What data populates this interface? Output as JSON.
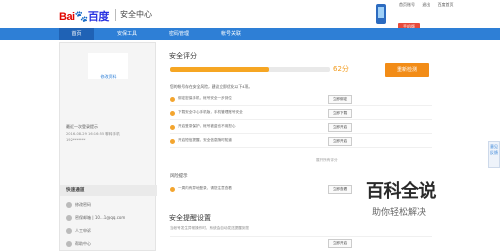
{
  "header": {
    "logo_prefix": "Bai",
    "logo_paw": "🐾",
    "logo_suffix": "百度",
    "product": "安全中心",
    "top_links": [
      "首页账号",
      "退出",
      "百度首页"
    ],
    "phone_badge": "手机版"
  },
  "nav": {
    "items": [
      {
        "label": "首页",
        "active": true
      },
      {
        "label": "安保工具",
        "active": false
      },
      {
        "label": "密码管理",
        "active": false
      },
      {
        "label": "帐号关联",
        "active": false
      }
    ]
  },
  "sidebar": {
    "avatar_link": "修改资料",
    "login_title": "最近一次登录提示",
    "login_lines": [
      "2016-08-29 16:16:55  聊转手机",
      "192*******"
    ],
    "quick_title": "快速通道",
    "quick_items": [
      "修改密码",
      "密保邮箱 | 10...1@qq.com",
      "人工申诉",
      "帮助中心"
    ]
  },
  "security": {
    "title": "安全评分",
    "score_label": "62分",
    "score_fraction": 0.62,
    "rescan_label": "重新检测",
    "risk_note": "您的帐号存在安全风险，建议立即优化以下4项。",
    "risks": [
      {
        "text": "绑定密保手机，帐号安全一步到位",
        "action": "立即绑定"
      },
      {
        "text": "下载安全中心手机版，手机管理账号安全",
        "action": "立即下载"
      },
      {
        "text": "开启登录保护，帐号被盗也不用担心",
        "action": "立即开启"
      },
      {
        "text": "开启短信提醒，安全信息随时知道",
        "action": "立即开启"
      }
    ],
    "more_link": "展开所有评分",
    "hint_title": "风险提示",
    "hint": {
      "text": "一周内有异地登录，请您注意查看",
      "action": "立即查看"
    }
  },
  "remind": {
    "title": "安全提醒设置",
    "subtitle": "当帐号发生异常操作时，系统会自动发送提醒到您",
    "row_action": "立即开启"
  },
  "side_tab": "意见反馈",
  "watermark": {
    "title": "百科全说",
    "subtitle": "助你轻松解决"
  },
  "colors": {
    "nav": "#2e7fd6",
    "accent": "#f28c17",
    "progress": "#f6a623"
  }
}
